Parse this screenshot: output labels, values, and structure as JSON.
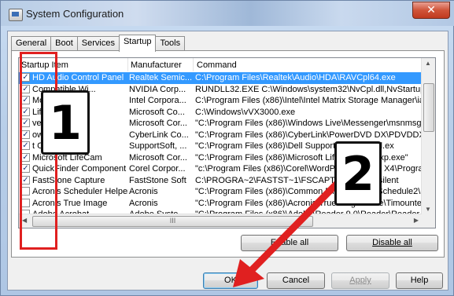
{
  "window": {
    "title": "System Configuration",
    "close_glyph": "✕"
  },
  "tabs": [
    "General",
    "Boot",
    "Services",
    "Startup",
    "Tools"
  ],
  "active_tab": "Startup",
  "list": {
    "columns": [
      "Startup Item",
      "Manufacturer",
      "Command"
    ],
    "rows": [
      {
        "checked": true,
        "item": "HD Audio Control Panel",
        "manufacturer": "Realtek Semic...",
        "command": "C:\\Program Files\\Realtek\\Audio\\HDA\\RAVCpl64.exe"
      },
      {
        "checked": true,
        "item": "Compatible Wi...",
        "manufacturer": "NVIDIA Corp...",
        "command": "RUNDLL32.EXE C:\\Windows\\system32\\NvCpl.dll,NvStartup"
      },
      {
        "checked": true,
        "item": "Monitor",
        "manufacturer": "Intel Corpora...",
        "command": "C:\\Program Files (x86)\\Intel\\Intel Matrix Storage Manager\\ia"
      },
      {
        "checked": true,
        "item": "LifeCam",
        "manufacturer": "Microsoft Co...",
        "command": "C:\\Windows\\vVX3000.exe"
      },
      {
        "checked": true,
        "item": "ve Messenger",
        "manufacturer": "Microsoft Cor...",
        "command": "\"C:\\Program Files (x86)\\Windows Live\\Messenger\\msnmsgr."
      },
      {
        "checked": true,
        "item": "owerDVD",
        "manufacturer": "CyberLink Co...",
        "command": "\"C:\\Program Files (x86)\\CyberLink\\PowerDVD DX\\PDVDDXS"
      },
      {
        "checked": true,
        "item": "t Center Up...",
        "manufacturer": "SupportSoft, ...",
        "command": "\"C:\\Program Files (x86)\\Dell Support\\bin\\sprtcmd.ex"
      },
      {
        "checked": true,
        "item": "Microsoft LifeCam",
        "manufacturer": "Microsoft Cor...",
        "command": "\"C:\\Program Files (x86)\\Microsoft LifeCam\\LifeExp.exe\""
      },
      {
        "checked": true,
        "item": "QuickFinder Component",
        "manufacturer": "Corel Corpor...",
        "command": "\"c:\\Program Files (x86)\\Corel\\WordPerfect Office X4\\Prograr"
      },
      {
        "checked": true,
        "item": "FastStone Capture",
        "manufacturer": "FastStone Soft",
        "command": "C:\\PROGRA~2\\FASTST~1\\FSCAPTURE.EXE -silent"
      },
      {
        "checked": false,
        "item": "Acronis Scheduler Helper",
        "manufacturer": "Acronis",
        "command": "\"C:\\Program Files (x86)\\Common Files\\Acronis\\Schedule2\\s"
      },
      {
        "checked": false,
        "item": "Acronis True Image",
        "manufacturer": "Acronis",
        "command": "\"C:\\Program Files (x86)\\Acronis\\TrueImageHome\\Timounter"
      },
      {
        "checked": false,
        "item": "Adobe Acrobat",
        "manufacturer": "Adobe Syste...",
        "command": "\"C:\\Program Files (x86)\\Adobe\\Reader 9.0\\Reader\\Reader_s"
      }
    ],
    "hscroll_grip": "III"
  },
  "buttons": {
    "enable_all": "Enable all",
    "disable_all": "Disable all",
    "ok": "OK",
    "cancel": "Cancel",
    "apply": "Apply",
    "help": "Help"
  },
  "annotations": {
    "badge_1": "1",
    "badge_2": "2",
    "highlight_color": "#e02020",
    "arrow_color": "#e02020"
  },
  "colors": {
    "selection": "#3399ff"
  }
}
